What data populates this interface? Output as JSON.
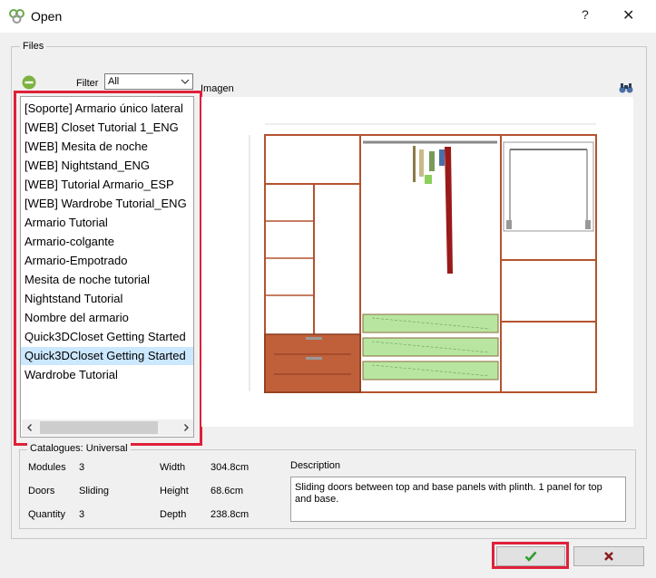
{
  "window": {
    "title": "Open",
    "help_label": "?",
    "close_label": "✕"
  },
  "files": {
    "group_label": "Files",
    "filter_label": "Filter",
    "filter_value": "All",
    "image_label": "Imagen",
    "items": [
      "[Soporte] Armario único lateral",
      "[WEB] Closet Tutorial 1_ENG",
      "[WEB] Mesita de noche",
      "[WEB] Nightstand_ENG",
      "[WEB] Tutorial Armario_ESP",
      "[WEB] Wardrobe Tutorial_ENG",
      "Armario Tutorial",
      "Armario-colgante",
      "Armario-Empotrado",
      "Mesita de noche tutorial",
      "Nightstand Tutorial",
      "Nombre del armario",
      "Quick3DCloset Getting Started",
      "Quick3DCloset Getting Started",
      "Wardrobe Tutorial"
    ],
    "selected_index": 13
  },
  "catalogue": {
    "group_label": "Catalogues: Universal",
    "modules_label": "Modules",
    "modules_value": "3",
    "doors_label": "Doors",
    "doors_value": "Sliding",
    "quantity_label": "Quantity",
    "quantity_value": "3",
    "width_label": "Width",
    "width_value": "304.8cm",
    "height_label": "Height",
    "height_value": "68.6cm",
    "depth_label": "Depth",
    "depth_value": "238.8cm",
    "description_label": "Description",
    "description_text": "Sliding doors between top and base panels with plinth. 1 panel for top and base."
  },
  "icons": {
    "app": "qc-app-icon",
    "remove": "remove-circle-icon",
    "dropdown": "chevron-down-icon",
    "search": "binoculars-icon",
    "ok": "checkmark-icon",
    "cancel": "x-icon"
  },
  "colors": {
    "highlight": "#e0203a",
    "selected_row": "#cce8ff",
    "ok_green": "#2e9e2e",
    "cancel_red": "#8b1a1a",
    "wood": "#b4532e",
    "drawer_green": "#b8e6a0"
  }
}
